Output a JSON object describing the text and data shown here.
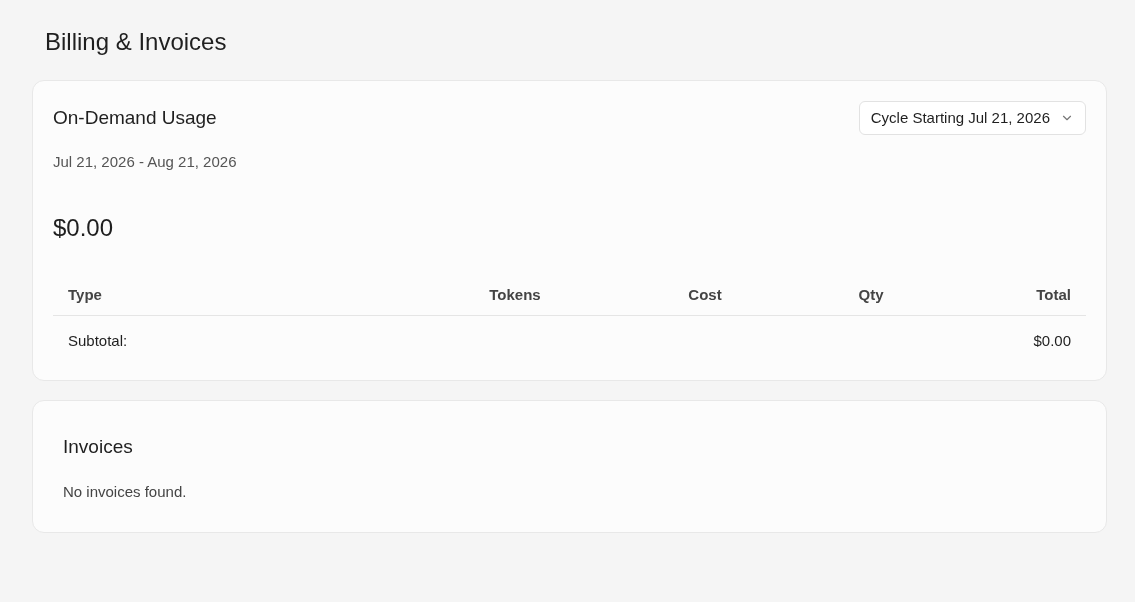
{
  "page_title": "Billing & Invoices",
  "usage": {
    "title": "On-Demand Usage",
    "cycle_select": {
      "value": "Cycle Starting Jul 21, 2026"
    },
    "period": "Jul 21, 2026 - Aug 21, 2026",
    "amount": "$0.00",
    "table": {
      "columns": [
        "Type",
        "Tokens",
        "Cost",
        "Qty",
        "Total"
      ],
      "subtotal": {
        "label": "Subtotal:",
        "total": "$0.00"
      }
    }
  },
  "invoices": {
    "title": "Invoices",
    "empty_message": "No invoices found."
  }
}
